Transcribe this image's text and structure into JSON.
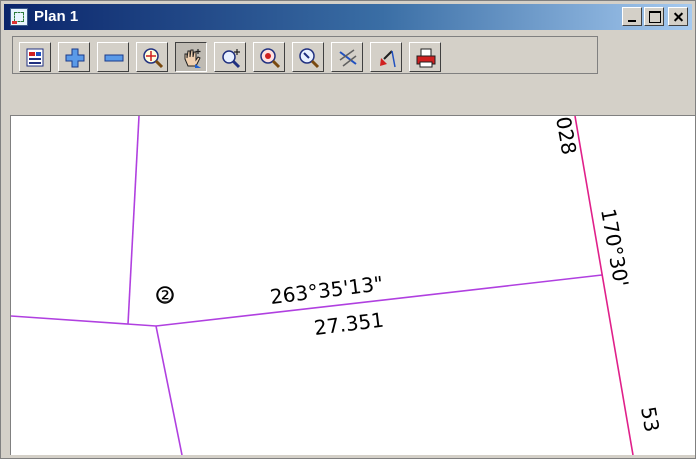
{
  "window": {
    "title": "Plan 1"
  },
  "toolbar": {
    "tools": [
      {
        "name": "plot-view",
        "icon": "plot-view-icon"
      },
      {
        "name": "zoom-in",
        "icon": "plus-icon"
      },
      {
        "name": "zoom-out",
        "icon": "minus-icon"
      },
      {
        "name": "zoom-extent",
        "icon": "zoom-extent-icon"
      },
      {
        "name": "pan",
        "icon": "pan-hand-icon",
        "active": true
      },
      {
        "name": "zoom-window",
        "icon": "zoom-window-icon"
      },
      {
        "name": "zoom-center",
        "icon": "zoom-center-icon"
      },
      {
        "name": "zoom-previous",
        "icon": "zoom-previous-icon"
      },
      {
        "name": "erase",
        "icon": "erase-icon"
      },
      {
        "name": "pick",
        "icon": "pick-icon"
      },
      {
        "name": "print",
        "icon": "print-icon"
      }
    ]
  },
  "plan": {
    "bearing_label": "263°35'13\"",
    "distance_label": "27.351",
    "point_label": "②",
    "right_bearing_label": "170°30'",
    "top_partial_label": "028",
    "bottom_partial_label": "53",
    "line_color": "#b040e0",
    "highlight_line_color": "#e0208a"
  }
}
